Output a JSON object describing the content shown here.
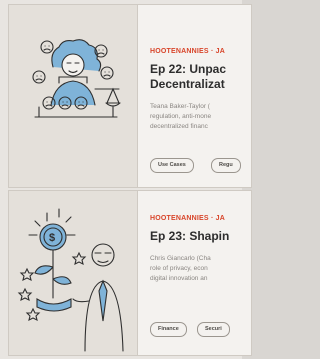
{
  "episodes": [
    {
      "category": "HOOTENANNIES · JA",
      "title_line1": "Ep 22: Unpac",
      "title_line2": "Decentralizat",
      "desc_line1": "Teana Baker-Taylor (",
      "desc_line2": "regulation, anti-mone",
      "desc_line3": "decentralized financ",
      "tags": [
        "Use Cases",
        "Regu"
      ]
    },
    {
      "category": "HOOTENANNIES · JA",
      "title_line1": "Ep 23: Shapin",
      "desc_line1": "Chris Giancarlo (Cha",
      "desc_line2": "role of privacy, econ",
      "desc_line3": "digital innovation an",
      "tags": [
        "Finance",
        "Securi"
      ]
    }
  ]
}
